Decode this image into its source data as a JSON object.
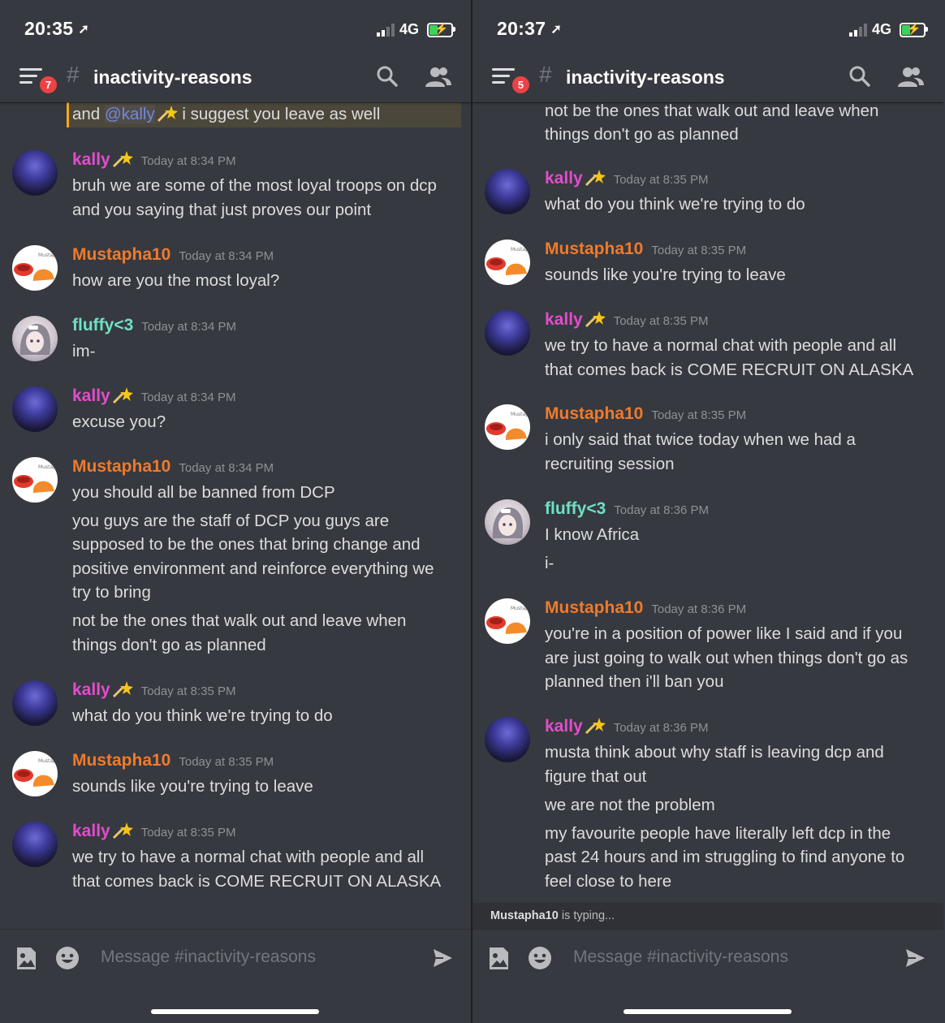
{
  "status_bar": {
    "left_time": "20:35",
    "right_time": "20:37",
    "network": "4G"
  },
  "header": {
    "left_badge": "7",
    "right_badge": "5",
    "hash": "#",
    "channel_name": "inactivity-reasons"
  },
  "composer": {
    "placeholder": "Message #inactivity-reasons"
  },
  "typing_indicator": {
    "user": "Mustapha10",
    "text": " is typing..."
  },
  "left_messages": {
    "m0": {
      "pre": "and ",
      "mention": "@kally",
      "post": " i suggest you leave as well"
    },
    "m1": {
      "author": "kally",
      "time": "Today at 8:34 PM",
      "l1": "bruh we are some of the most loyal troops on dcp",
      "l2": "and you saying that just proves our point"
    },
    "m2": {
      "author": "Mustapha10",
      "time": "Today at 8:34 PM",
      "l1": "how are you the most loyal?"
    },
    "m3": {
      "author": "fluffy<3",
      "time": "Today at 8:34 PM",
      "l1": "im-"
    },
    "m4": {
      "author": "kally",
      "time": "Today at 8:34 PM",
      "l1": "excuse you?"
    },
    "m5": {
      "author": "Mustapha10",
      "time": "Today at 8:34 PM",
      "l1": "you should all be banned from DCP",
      "l2": "you guys are the staff of DCP you guys are",
      "l3": "supposed to be the ones that bring change and",
      "l4": "positive environment and reinforce everything we",
      "l5": "try to bring",
      "l6": "not be the ones that walk out and leave when",
      "l7": "things don't go as planned"
    },
    "m6": {
      "author": "kally",
      "time": "Today at 8:35 PM",
      "l1": "what do you think we're trying to do"
    },
    "m7": {
      "author": "Mustapha10",
      "time": "Today at 8:35 PM",
      "l1": "sounds like you're trying to leave"
    },
    "m8": {
      "author": "kally",
      "time": "Today at 8:35 PM",
      "l1": "we try to have a normal chat with people and all",
      "l2": "that comes back is COME RECRUIT ON ALASKA"
    }
  },
  "right_messages": {
    "m0": {
      "l1": "not be the ones that walk out and leave when",
      "l2": "things don't go as planned"
    },
    "m1": {
      "author": "kally",
      "time": "Today at 8:35 PM",
      "l1": "what do you think we're trying to do"
    },
    "m2": {
      "author": "Mustapha10",
      "time": "Today at 8:35 PM",
      "l1": "sounds like you're trying to leave"
    },
    "m3": {
      "author": "kally",
      "time": "Today at 8:35 PM",
      "l1": "we try to have a normal chat with people and all",
      "l2": "that comes back is COME RECRUIT ON ALASKA"
    },
    "m4": {
      "author": "Mustapha10",
      "time": "Today at 8:35 PM",
      "l1": "i only said that twice today when we had a",
      "l2": "recruiting session"
    },
    "m5": {
      "author": "fluffy<3",
      "time": "Today at 8:36 PM",
      "l1": "I know Africa",
      "l2": "i-"
    },
    "m6": {
      "author": "Mustapha10",
      "time": "Today at 8:36 PM",
      "l1": "you're in a position of power like I said and if you",
      "l2": "are just going to walk out when things don't go as",
      "l3": "planned then i'll ban you"
    },
    "m7": {
      "author": "kally",
      "time": "Today at 8:36 PM",
      "l1": "musta think about why staff is leaving dcp and",
      "l2": "figure that out",
      "l3": "we are not the problem",
      "l4": "my favourite people have literally left dcp in the",
      "l5": "past 24 hours and im struggling to find anyone to",
      "l6": "feel close to here"
    }
  },
  "icons": {
    "menu": "hamburger-menu-icon",
    "search": "search-icon",
    "members": "members-icon",
    "image": "image-upload-icon",
    "emoji": "emoji-icon",
    "send": "send-icon",
    "kally_badge": "shooting-star-emoji-icon"
  },
  "colors": {
    "background": "#36393f",
    "kally": "#e34ccd",
    "mustapha": "#f07a2c",
    "fluffy": "#6fe0c3",
    "mention_highlight": "#faa61a",
    "badge": "#ed4245"
  }
}
